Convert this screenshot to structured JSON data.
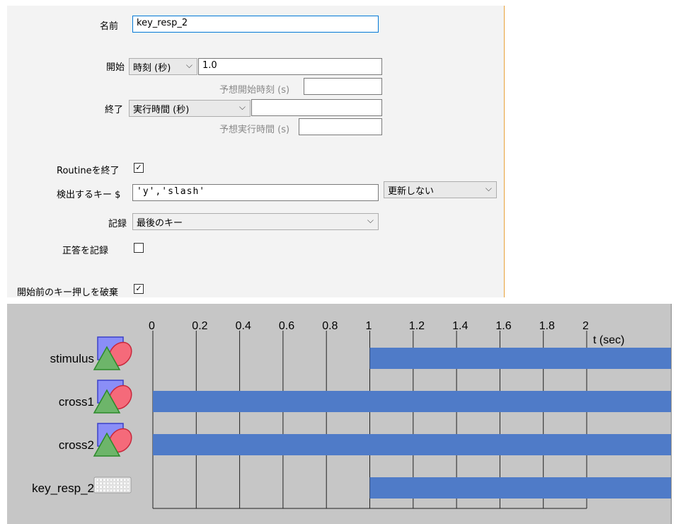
{
  "dialog": {
    "name_label": "名前",
    "name_value": "key_resp_2",
    "start_label": "開始",
    "start_type": "時刻 (秒)",
    "start_value": "1.0",
    "expected_start_label": "予想開始時刻 (s)",
    "expected_start_value": "",
    "stop_label": "終了",
    "stop_type": "実行時間 (秒)",
    "stop_value": "",
    "expected_duration_label": "予想実行時間 (s)",
    "expected_duration_value": "",
    "force_end_label": "Routineを終了",
    "force_end_checked": true,
    "keys_label": "検出するキー $",
    "keys_value": "'y','slash'",
    "keys_update": "更新しない",
    "store_label": "記録",
    "store_value": "最後のキー",
    "store_correct_label": "正答を記録",
    "store_correct_checked": false,
    "discard_label": "開始前のキー押しを破棄",
    "discard_checked": true
  },
  "timeline": {
    "axis_label": "t (sec)",
    "ticks": [
      "0",
      "0.2",
      "0.4",
      "0.6",
      "0.8",
      "1",
      "1.2",
      "1.4",
      "1.6",
      "1.8",
      "2"
    ],
    "bar_color": "#4f7bc8",
    "components": [
      {
        "name": "stimulus",
        "icon": "visual-stimulus-icon",
        "start": 1.0,
        "end": null
      },
      {
        "name": "cross1",
        "icon": "visual-stimulus-icon",
        "start": 0.0,
        "end": null
      },
      {
        "name": "cross2",
        "icon": "visual-stimulus-icon",
        "start": 0.0,
        "end": null
      },
      {
        "name": "key_resp_2",
        "icon": "keyboard-icon",
        "start": 1.0,
        "end": null
      }
    ]
  }
}
